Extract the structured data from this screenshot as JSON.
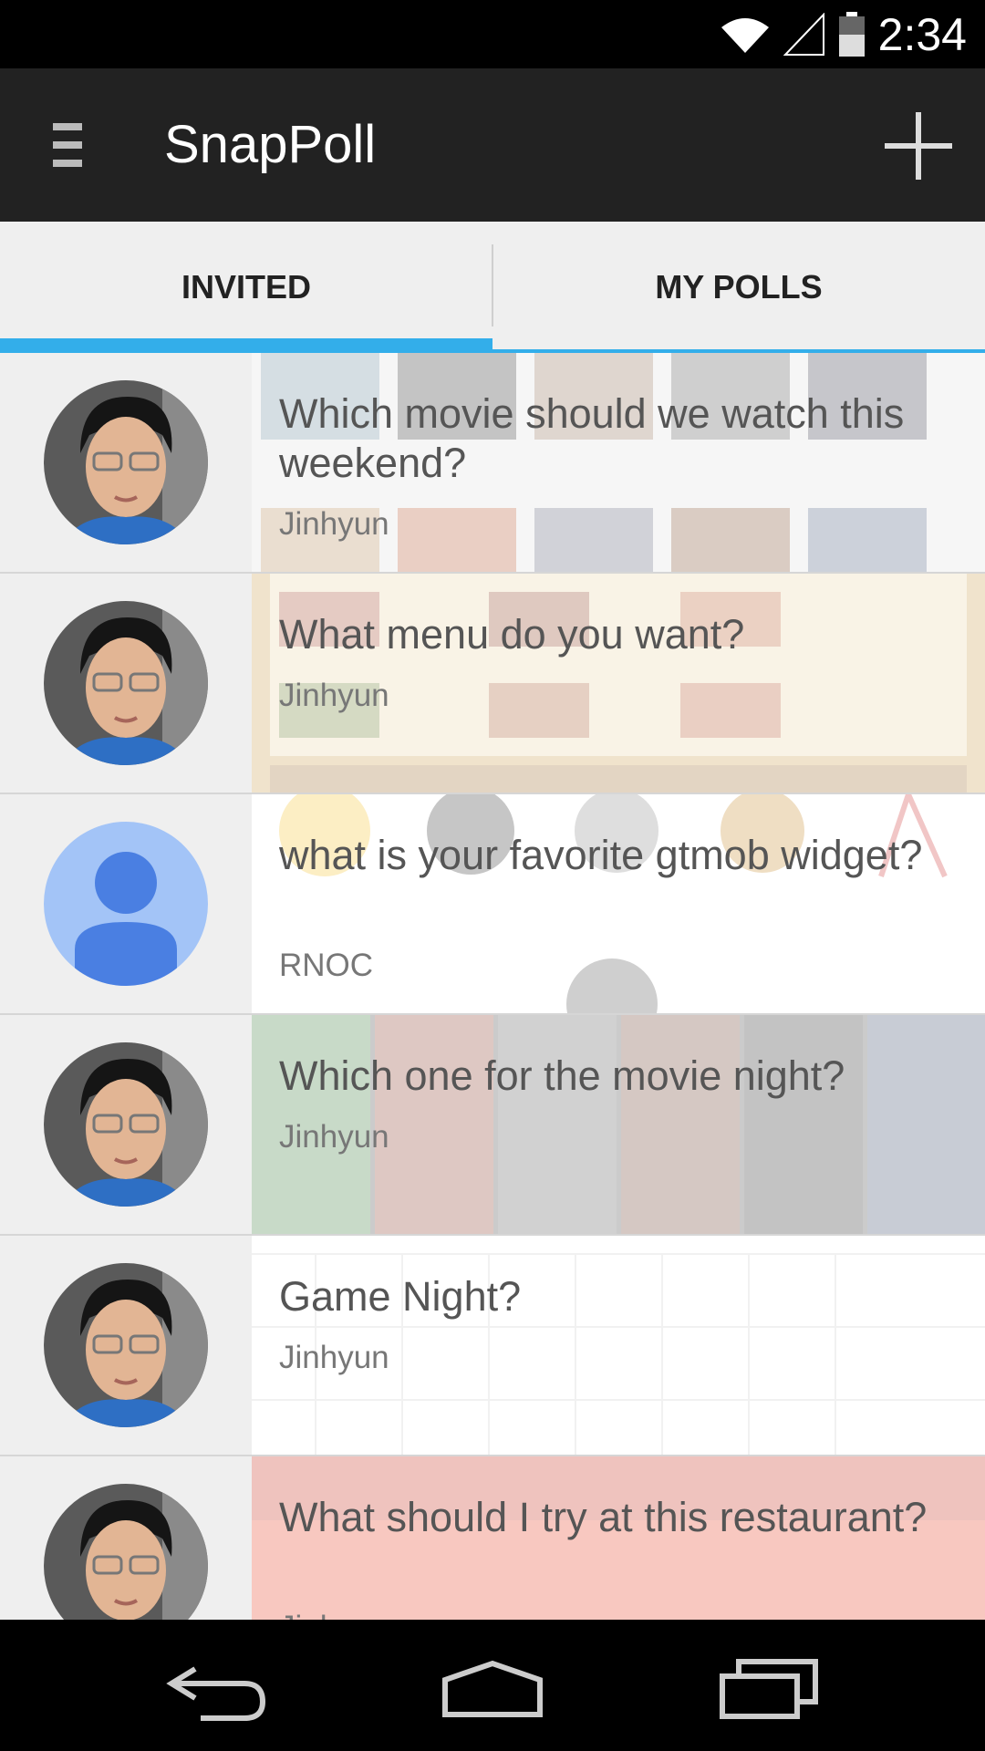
{
  "status_bar": {
    "time": "2:34",
    "icons": [
      "wifi-icon",
      "signal-icon",
      "battery-icon"
    ]
  },
  "app_bar": {
    "title": "SnapPoll",
    "menu_icon": "menu-icon",
    "add_icon": "add-icon"
  },
  "tabs": [
    {
      "label": "INVITED",
      "selected": true
    },
    {
      "label": "MY POLLS",
      "selected": false
    }
  ],
  "accent_color": "#33aeea",
  "polls": [
    {
      "question": "Which movie should we watch this weekend?",
      "author": "Jinhyun",
      "avatar": "person-photo",
      "background": "movie-posters"
    },
    {
      "question": "What menu do you want?",
      "author": "Jinhyun",
      "avatar": "person-photo",
      "background": "menu"
    },
    {
      "question": "what is your favorite gtmob widget?",
      "author": "RNOC",
      "avatar": "default-avatar-icon",
      "background": "app-icons"
    },
    {
      "question": "Which one for the movie night?",
      "author": "Jinhyun",
      "avatar": "person-photo",
      "background": "movie-posters"
    },
    {
      "question": "Game Night?",
      "author": "Jinhyun",
      "avatar": "person-photo",
      "background": "calendar"
    },
    {
      "question": "What should I try at this restaurant?",
      "author": "Jinhyun",
      "avatar": "person-photo",
      "background": "chinese-menu"
    }
  ],
  "nav_bar": {
    "buttons": [
      "back-icon",
      "home-icon",
      "recents-icon"
    ]
  }
}
